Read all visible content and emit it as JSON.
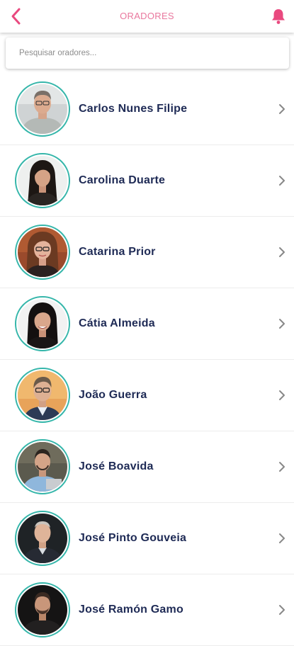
{
  "header": {
    "title": "ORADORES",
    "back_icon": "chevron-left-icon",
    "notification_icon": "bell-icon",
    "accent_color": "#e9497f"
  },
  "search": {
    "placeholder": "Pesquisar oradores...",
    "value": ""
  },
  "speakers": [
    {
      "name": "Carlos Nunes Filipe"
    },
    {
      "name": "Carolina Duarte"
    },
    {
      "name": "Catarina Prior"
    },
    {
      "name": "Cátia Almeida"
    },
    {
      "name": "João Guerra"
    },
    {
      "name": "José Boavida"
    },
    {
      "name": "José Pinto Gouveia"
    },
    {
      "name": "José Ramón Gamo"
    }
  ],
  "colors": {
    "avatar_ring": "#35b6aa",
    "name_text": "#1e2a55",
    "chevron": "#888888"
  }
}
